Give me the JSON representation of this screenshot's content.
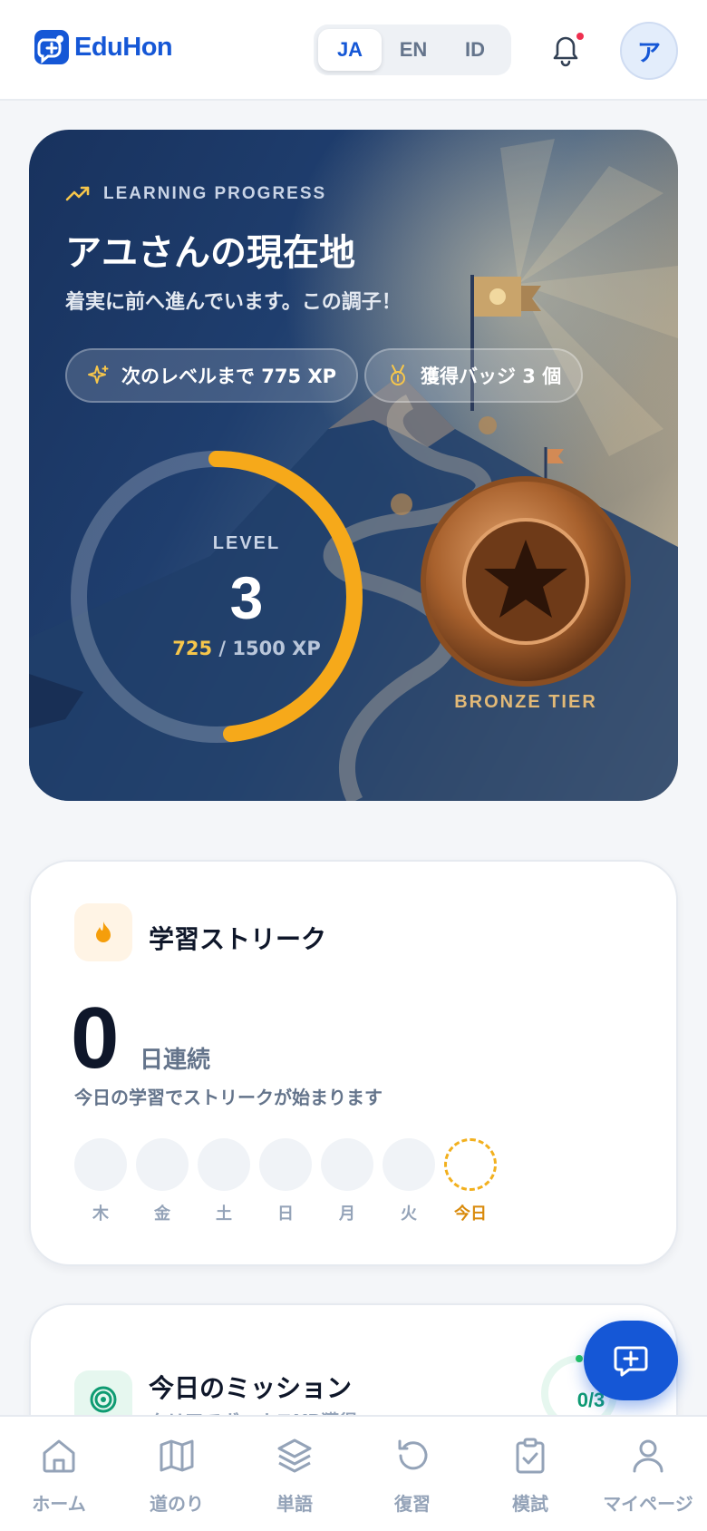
{
  "header": {
    "logo_text": "EduHon",
    "languages": [
      "JA",
      "EN",
      "ID"
    ],
    "active_language": "JA",
    "avatar_initial": "ア"
  },
  "hero": {
    "eyebrow": "LEARNING PROGRESS",
    "title": "アユさんの現在地",
    "subtitle": "着実に前へ進んでいます。この調子！",
    "chip_next_level": "次のレベルまで 775 XP",
    "chip_badges": "獲得バッジ 3 個",
    "level_label": "LEVEL",
    "level": "3",
    "xp_current": "725",
    "xp_separator": " / ",
    "xp_total": "1500 XP",
    "progress_fraction": 0.483,
    "tier": "BRONZE TIER"
  },
  "streak": {
    "title": "学習ストリーク",
    "count": "0",
    "unit": "日連続",
    "message": "今日の学習でストリークが始まります",
    "days": [
      "木",
      "金",
      "土",
      "日",
      "月",
      "火",
      "今日"
    ]
  },
  "mission": {
    "title": "今日のミッション",
    "subtitle": "クリアでボーナスXP獲得",
    "count": "0/3"
  },
  "nav": {
    "items": [
      "ホーム",
      "道のり",
      "単語",
      "復習",
      "模試",
      "マイページ"
    ]
  },
  "colors": {
    "brand": "#1557d6",
    "accent_gold": "#f6a91a",
    "bronze": "#c27a3c",
    "streak_today": "#f2b01e",
    "mission_green": "#0f9b72"
  }
}
